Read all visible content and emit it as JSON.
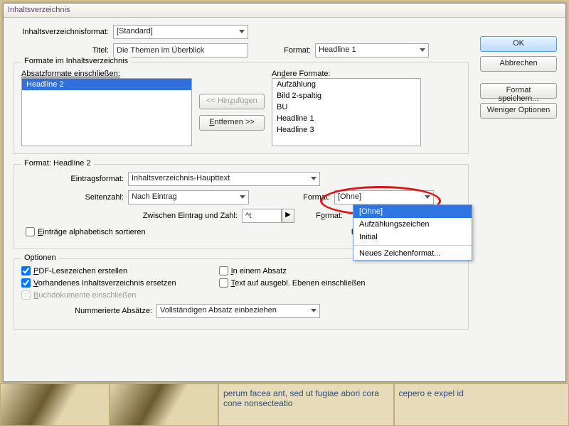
{
  "window": {
    "title": "Inhaltsverzeichnis"
  },
  "top": {
    "tocFormatLabel": "Inhaltsverzeichnisformat:",
    "tocFormatValue": "[Standard]",
    "titleLabel": "Titel:",
    "titleValue": "Die Themen im Überblick",
    "formatLabel": "Format:",
    "formatValue": "Headline 1"
  },
  "buttons": {
    "ok": "OK",
    "cancel": "Abbrechen",
    "saveFormat": "Format speichern...",
    "fewerOptions": "Weniger Optionen"
  },
  "formats": {
    "legend": "Formate im Inhaltsverzeichnis",
    "includeLabel": "Absatzformate einschließen:",
    "includedItems": [
      "Headline 2"
    ],
    "addBtn": "<< Hinzufügen",
    "removeBtn": "Entfernen >>",
    "otherLabel": "Andere Formate:",
    "otherItems": [
      "Aufzählung",
      "Bild 2-spaltig",
      "BU",
      "Headline 1",
      "Headline 3"
    ]
  },
  "entry": {
    "legend": "Format: Headline 2",
    "entryFormatLabel": "Eintragsformat:",
    "entryFormatValue": "Inhaltsverzeichnis-Haupttext",
    "pageNumLabel": "Seitenzahl:",
    "pageNumValue": "Nach Eintrag",
    "formatLabel": "Format:",
    "formatValue": "[Ohne]",
    "betweenLabel": "Zwischen Eintrag und Zahl:",
    "betweenValue": "^t",
    "format2Label": "Format:",
    "levelLabel": "Ebene:",
    "sortLabel": "Einträge alphabetisch sortieren"
  },
  "dropdown": {
    "options": [
      "[Ohne]",
      "Aufzählungszeichen",
      "Initial"
    ],
    "newFmt": "Neues Zeichenformat...",
    "selected": "[Ohne]"
  },
  "options": {
    "legend": "Optionen",
    "pdf": "PDF-Lesezeichen erstellen",
    "oneParagraph": "In einem Absatz",
    "replace": "Vorhandenes Inhaltsverzeichnis ersetzen",
    "hiddenLayers": "Text auf ausgebl. Ebenen einschließen",
    "bookDocs": "Buchdokumente einschließen",
    "numberedLabel": "Nummerierte Absätze:",
    "numberedValue": "Vollständigen Absatz einbeziehen"
  },
  "bgtext": {
    "col1": "perum facea ant, sed ut fugiae abori cora cone nonsecteatio",
    "col2": "cepero e expel id"
  }
}
